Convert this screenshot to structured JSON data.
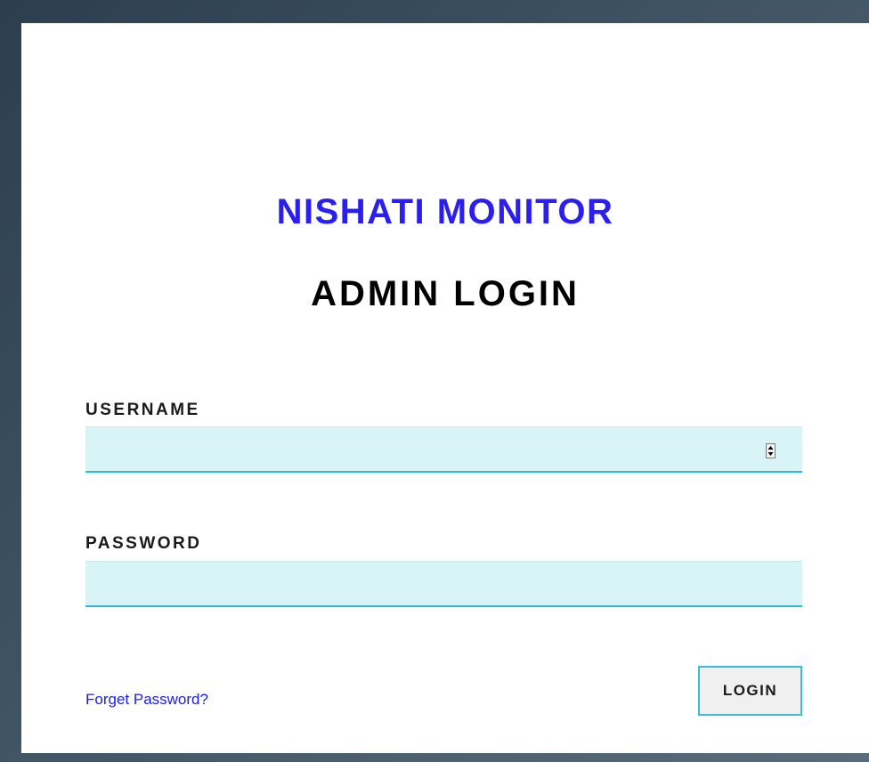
{
  "header": {
    "app_title": "NISHATI MONITOR",
    "page_title": "ADMIN LOGIN"
  },
  "form": {
    "username": {
      "label": "USERNAME",
      "value": "",
      "placeholder": ""
    },
    "password": {
      "label": "PASSWORD",
      "value": "",
      "placeholder": ""
    },
    "forgot_password_label": "Forget Password?",
    "login_label": "LOGIN"
  },
  "icons": {
    "username_spinner": "spinner-arrows-icon"
  },
  "colors": {
    "app_title": "#2b1ff0",
    "link": "#1d1de0",
    "field_background": "#d9f4f6",
    "field_underline": "#2fb8cf",
    "button_border": "#3dbdd3"
  }
}
